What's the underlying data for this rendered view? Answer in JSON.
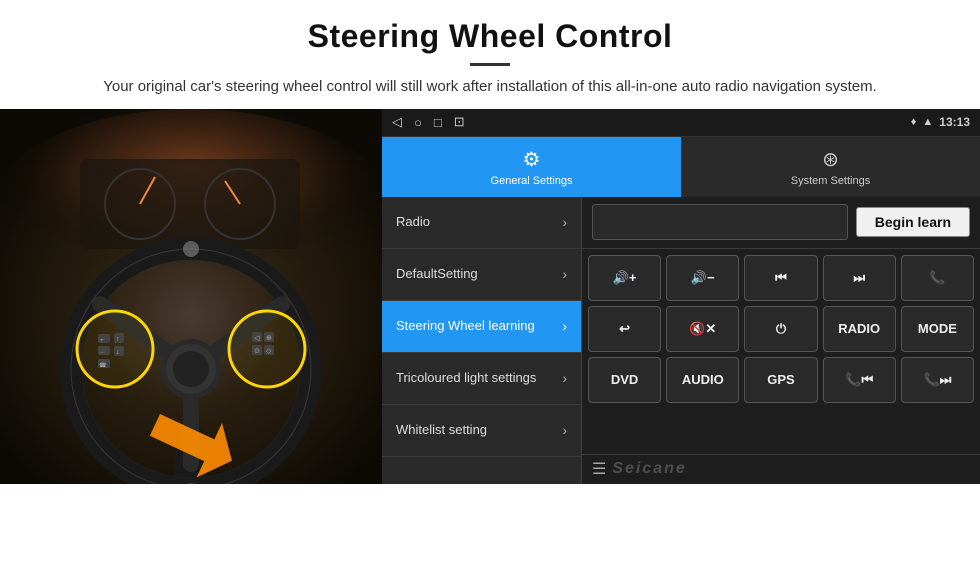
{
  "header": {
    "title": "Steering Wheel Control",
    "subtitle": "Your original car's steering wheel control will still work after installation of this all-in-one auto radio navigation system."
  },
  "android_ui": {
    "status_bar": {
      "time": "13:13",
      "icons": [
        "◁",
        "○",
        "□",
        "⊡"
      ]
    },
    "tabs": [
      {
        "id": "general",
        "label": "General Settings",
        "icon": "⚙",
        "active": true
      },
      {
        "id": "system",
        "label": "System Settings",
        "icon": "⊛",
        "active": false
      }
    ],
    "menu_items": [
      {
        "id": "radio",
        "label": "Radio",
        "active": false
      },
      {
        "id": "default",
        "label": "DefaultSetting",
        "active": false
      },
      {
        "id": "steering",
        "label": "Steering Wheel learning",
        "active": true
      },
      {
        "id": "tricoloured",
        "label": "Tricoloured light settings",
        "active": false
      },
      {
        "id": "whitelist",
        "label": "Whitelist setting",
        "active": false
      }
    ],
    "begin_learn_label": "Begin learn",
    "button_rows": [
      [
        {
          "id": "vol-up",
          "label": "🔊+",
          "text": "🔊+"
        },
        {
          "id": "vol-down",
          "label": "🔊−",
          "text": "🔊−"
        },
        {
          "id": "prev",
          "label": "⏮",
          "text": "⏮"
        },
        {
          "id": "next",
          "label": "⏭",
          "text": "⏭"
        },
        {
          "id": "phone",
          "label": "📞",
          "text": "📞"
        }
      ],
      [
        {
          "id": "end-call",
          "label": "☎",
          "text": "↩"
        },
        {
          "id": "mute",
          "label": "🔇x",
          "text": "🔇x"
        },
        {
          "id": "power",
          "label": "⏻",
          "text": "⏻"
        },
        {
          "id": "radio-btn",
          "label": "RADIO",
          "text": "RADIO"
        },
        {
          "id": "mode",
          "label": "MODE",
          "text": "MODE"
        }
      ],
      [
        {
          "id": "dvd",
          "label": "DVD",
          "text": "DVD"
        },
        {
          "id": "audio",
          "label": "AUDIO",
          "text": "AUDIO"
        },
        {
          "id": "gps",
          "label": "GPS",
          "text": "GPS"
        },
        {
          "id": "tel-prev",
          "label": "📞⏮",
          "text": "📞⏮"
        },
        {
          "id": "tel-next",
          "label": "📞⏭",
          "text": "📞⏭"
        }
      ]
    ],
    "watermark": "Seicane"
  }
}
